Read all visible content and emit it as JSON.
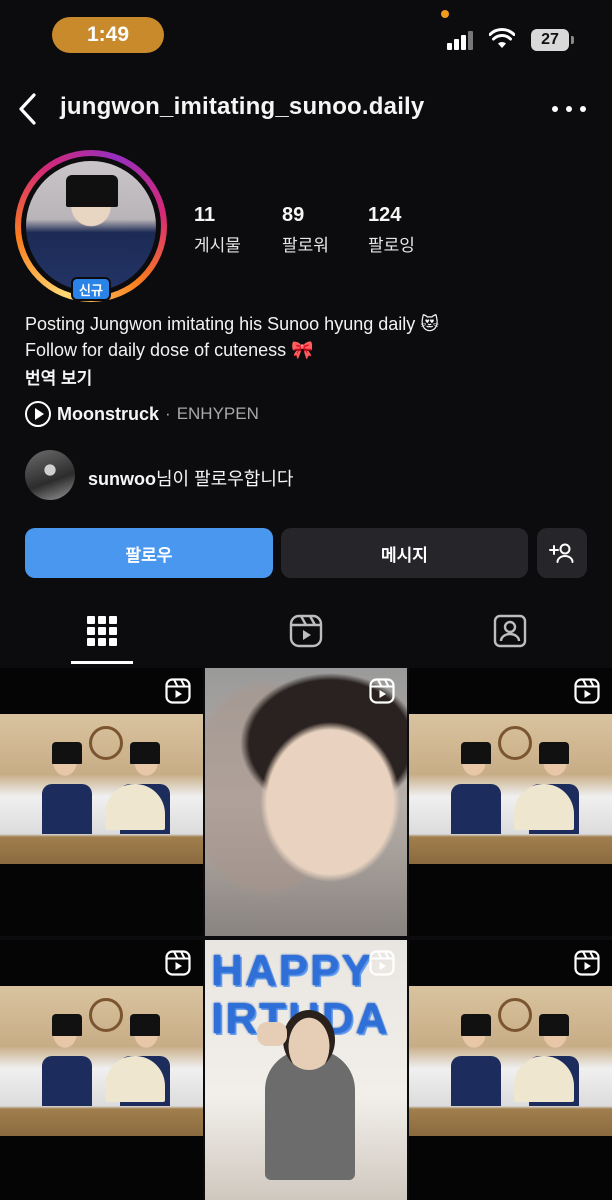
{
  "status_bar": {
    "time": "1:49",
    "battery": "27"
  },
  "header": {
    "username": "jungwon_imitating_sunoo.daily"
  },
  "profile": {
    "badge": "신규",
    "stats": [
      {
        "value": "11",
        "label": "게시물"
      },
      {
        "value": "89",
        "label": "팔로워"
      },
      {
        "value": "124",
        "label": "팔로잉"
      }
    ],
    "bio_lines": [
      "Posting Jungwon imitating his Sunoo hyung daily 😻",
      "Follow for daily dose of cuteness 🎀"
    ],
    "translate_label": "번역 보기",
    "music": {
      "song": "Moonstruck",
      "separator": "·",
      "artist": "ENHYPEN"
    },
    "followed_by": {
      "name": "sunwoo",
      "suffix": "님이 팔로우합니다"
    }
  },
  "actions": {
    "follow": "팔로우",
    "message": "메시지"
  },
  "tabs": [
    {
      "name": "grid",
      "icon": "grid-icon",
      "active": true
    },
    {
      "name": "reels",
      "icon": "reels-icon",
      "active": false
    },
    {
      "name": "tagged",
      "icon": "tagged-icon",
      "active": false
    }
  ],
  "posts": [
    {
      "type": "reel",
      "thumbnail": "two-scholars-hanbok"
    },
    {
      "type": "reel",
      "thumbnail": "closeup-portrait"
    },
    {
      "type": "reel",
      "thumbnail": "two-scholars-hanbok"
    },
    {
      "type": "reel",
      "thumbnail": "two-scholars-hanbok"
    },
    {
      "type": "reel",
      "thumbnail": "happy-birthday",
      "text_line1": "HAPPY",
      "text_line2": "IRTHDA"
    },
    {
      "type": "reel",
      "thumbnail": "two-scholars-hanbok"
    }
  ],
  "colors": {
    "background": "#0c0c0e",
    "follow_button": "#4a97f0",
    "secondary_button": "#26262a",
    "badge": "#2a84e8"
  }
}
